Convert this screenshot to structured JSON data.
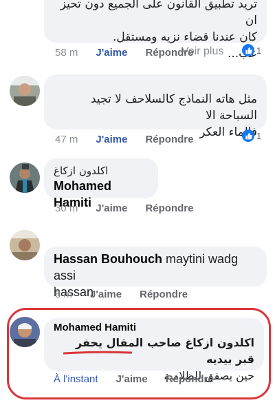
{
  "comments": [
    {
      "lines": [
        "تريد تطبيق القانون على الجميع دون تحيز ان",
        "كان عندنا قضاء نزيه ومستقل.",
        "عب..."
      ],
      "voir_plus": "Voir plus",
      "time": "58 m",
      "like": "J'aime",
      "reply": "Répondre",
      "reactions": "1"
    },
    {
      "lines": [
        "مثل هاته النماذج كالسلاحف لا تجيد السباحة الا",
        "فالماء العكر"
      ],
      "time": "47 m",
      "like": "J'aime",
      "reply": "Répondre",
      "reactions": "1"
    },
    {
      "author_ar": "اكلدون ازكاغ",
      "name": "Mohamed Hamiti",
      "time": "30 m",
      "like": "J'aime",
      "reply": "Répondre"
    },
    {
      "name": "Hassan Bouhouch",
      "text_rest": " maytini wadg assi",
      "text_line2": "hassan",
      "time": "8 m",
      "like": "J'aime",
      "reply": "Répondre"
    },
    {
      "author": "Mohamed Hamiti",
      "lines": [
        "اكلدون ازكاغ صاحب المقال يحفر قبر بيديه",
        "حين يصفق للظلامية"
      ],
      "time": "À l'instant",
      "like": "J'aime",
      "reply": "Répondre"
    }
  ],
  "colors": {
    "accent": "#2f57a7",
    "bubble": "#f0f2f5",
    "highlight": "#d8363a",
    "reaction": "#1877f2"
  },
  "icons": [
    "like-reaction-icon",
    "avatar"
  ]
}
